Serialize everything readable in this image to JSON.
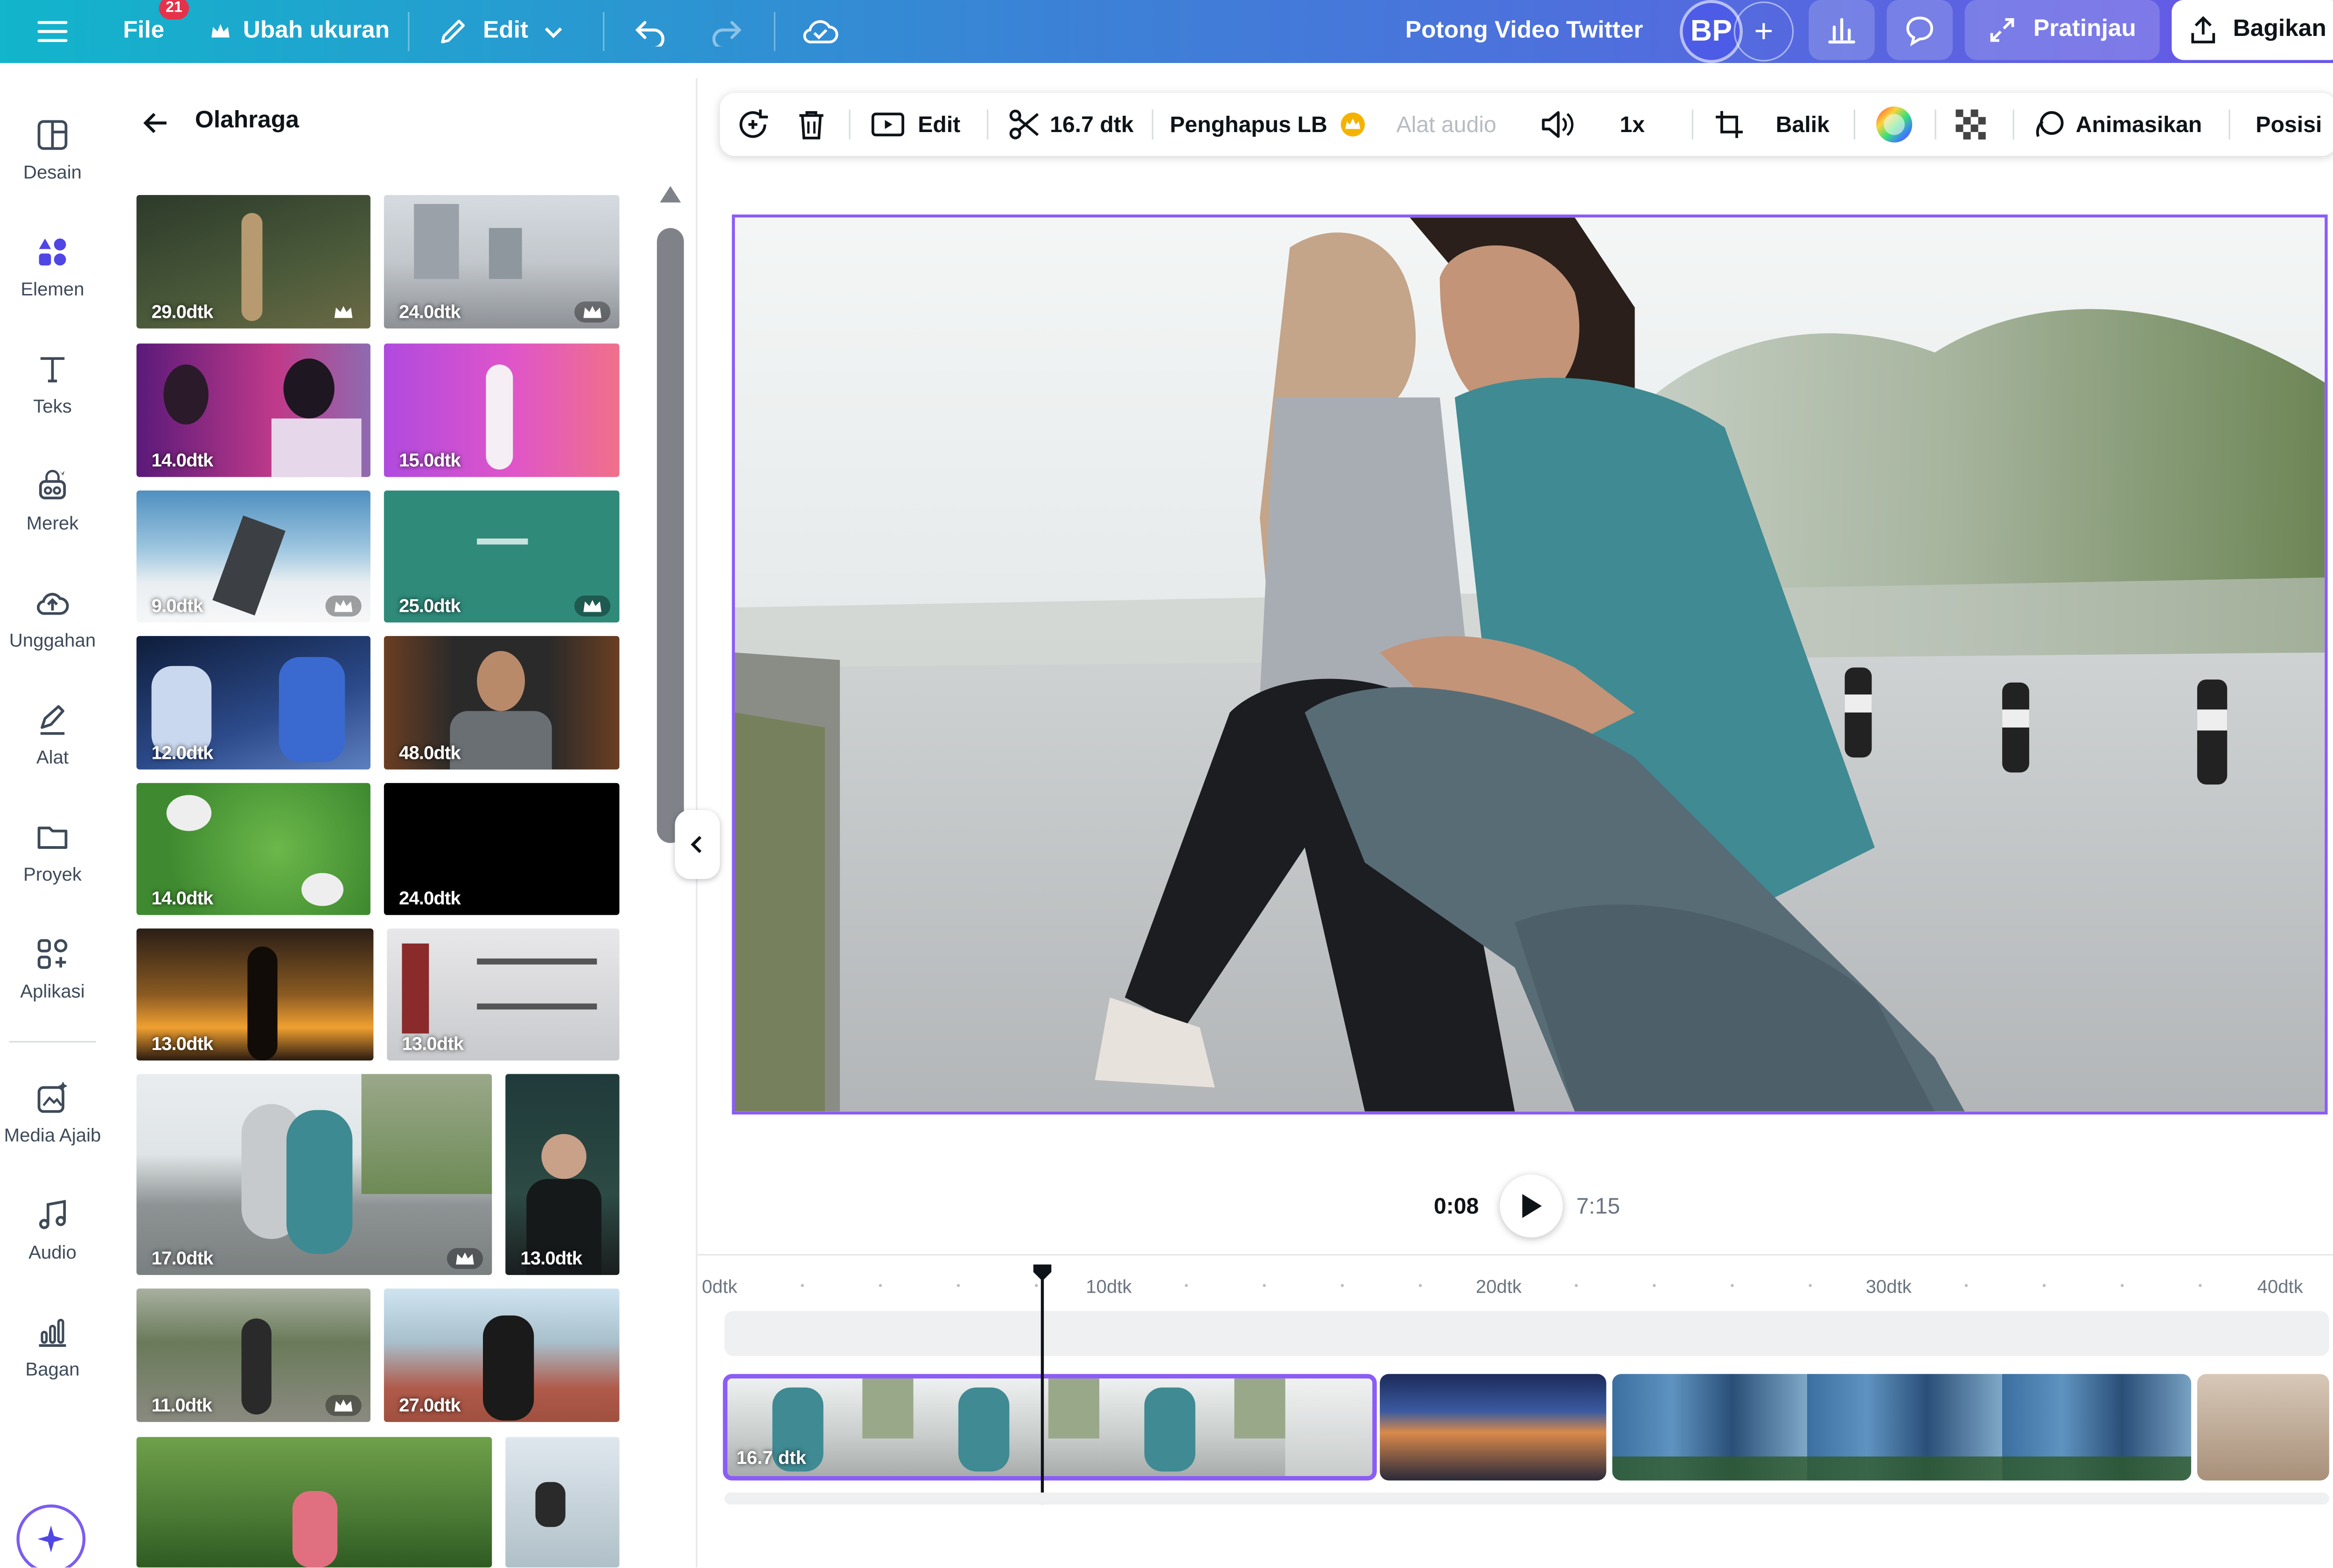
{
  "topbar": {
    "file_label": "File",
    "file_badge": "21",
    "resize_label": "Ubah ukuran",
    "edit_label": "Edit",
    "doc_title": "Potong Video Twitter",
    "avatar_initials": "BP",
    "preview_label": "Pratinjau",
    "share_label": "Bagikan"
  },
  "leftnav": {
    "items": [
      {
        "label": "Desain",
        "icon": "layout-icon"
      },
      {
        "label": "Elemen",
        "icon": "shapes-icon"
      },
      {
        "label": "Teks",
        "icon": "text-icon"
      },
      {
        "label": "Merek",
        "icon": "brand-icon"
      },
      {
        "label": "Unggahan",
        "icon": "upload-cloud-icon"
      },
      {
        "label": "Alat",
        "icon": "pen-icon"
      },
      {
        "label": "Proyek",
        "icon": "folder-icon"
      },
      {
        "label": "Aplikasi",
        "icon": "apps-icon"
      },
      {
        "label": "Media Ajaib",
        "icon": "magic-media-icon"
      },
      {
        "label": "Audio",
        "icon": "music-icon"
      },
      {
        "label": "Bagan",
        "icon": "chart-icon"
      }
    ]
  },
  "panel": {
    "title": "Olahraga",
    "videos": [
      "29.0dtk",
      "24.0dtk",
      "14.0dtk",
      "15.0dtk",
      "9.0dtk",
      "25.0dtk",
      "12.0dtk",
      "48.0dtk",
      "14.0dtk",
      "24.0dtk",
      "13.0dtk",
      "13.0dtk",
      "17.0dtk",
      "13.0dtk",
      "11.0dtk",
      "27.0dtk"
    ]
  },
  "toolbar": {
    "edit_label": "Edit",
    "trim_label": "16.7 dtk",
    "bg_remover_label": "Penghapus LB",
    "audio_tools_label": "Alat audio",
    "speed_label": "1x",
    "flip_label": "Balik",
    "animate_label": "Animasikan",
    "position_label": "Posisi"
  },
  "playback": {
    "current_time": "0:08",
    "total_time": "7:15"
  },
  "timeline": {
    "ruler": [
      "0dtk",
      "10dtk",
      "20dtk",
      "30dtk",
      "40dtk"
    ],
    "selected_clip_label": "16.7 dtk"
  },
  "colors": {
    "accent": "#8b5cf6",
    "topbar_start": "#12b5cb",
    "topbar_end": "#6a55e6"
  }
}
